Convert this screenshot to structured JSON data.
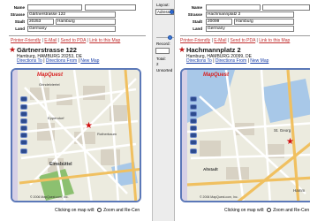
{
  "left": {
    "form": {
      "name_label": "Name",
      "name_value": "",
      "street_label": "Strasse",
      "street_value": "Gärtnerstrasse 122",
      "zip_label": "Stadt",
      "zip_value": "20253",
      "city_value": "Hamburg",
      "country_label": "Land",
      "country_value": "Germany"
    },
    "links": [
      "Printer-Friendly",
      "E-Mail",
      "Send to PDA",
      "Link to this Map"
    ],
    "address_title": "Gärtnerstrasse 122",
    "address_sub": "Hamburg, HAMBURG 20253, DE",
    "direction_links": [
      "Directions To",
      "Directions From",
      "New Map"
    ],
    "brand": "MapQuest",
    "places": [
      "Grindelviertel",
      "Eimsbüttel",
      "Rotherbaum",
      "Eppendorf"
    ],
    "copyright": "© 2006 MapQuest.com, Inc.",
    "caption": "Clicking on map will:",
    "caption_option": "Zoom and Re-Cen"
  },
  "sidebar": {
    "layout_label": "Layout:",
    "layout_value": "Adresse",
    "record_label": "Record:",
    "total_label": "Total:",
    "total_value": "2",
    "status": "Unsorted"
  },
  "right": {
    "form": {
      "name_label": "Name",
      "name_value": "",
      "street_label": "Strasse",
      "street_value": "Hachmannplatz 2",
      "zip_label": "Stadt",
      "zip_value": "20099",
      "city_value": "Hamburg",
      "country_label": "Land",
      "country_value": "Germany"
    },
    "links": [
      "Printer-Friendly",
      "E-Mail",
      "Send to PDA",
      "Link to this Map"
    ],
    "address_title": "Hachmannplatz 2",
    "address_sub": "Hamburg, HAMBURG 20099, DE",
    "direction_links": [
      "Directions To",
      "Directions From",
      "New Map"
    ],
    "brand": "MapQuest",
    "places": [
      "Altstadt",
      "St. Georg",
      "Hamm"
    ],
    "copyright": "© 2006 MapQuest.com, Inc.",
    "caption": "Clicking on map will:",
    "caption_option": "Zoom and Re-Cen"
  },
  "colors": {
    "accent_red": "#c03030",
    "link_blue": "#1a3fa8",
    "map_border": "#5b78b8",
    "zoom_button": "#2d4b8e"
  }
}
